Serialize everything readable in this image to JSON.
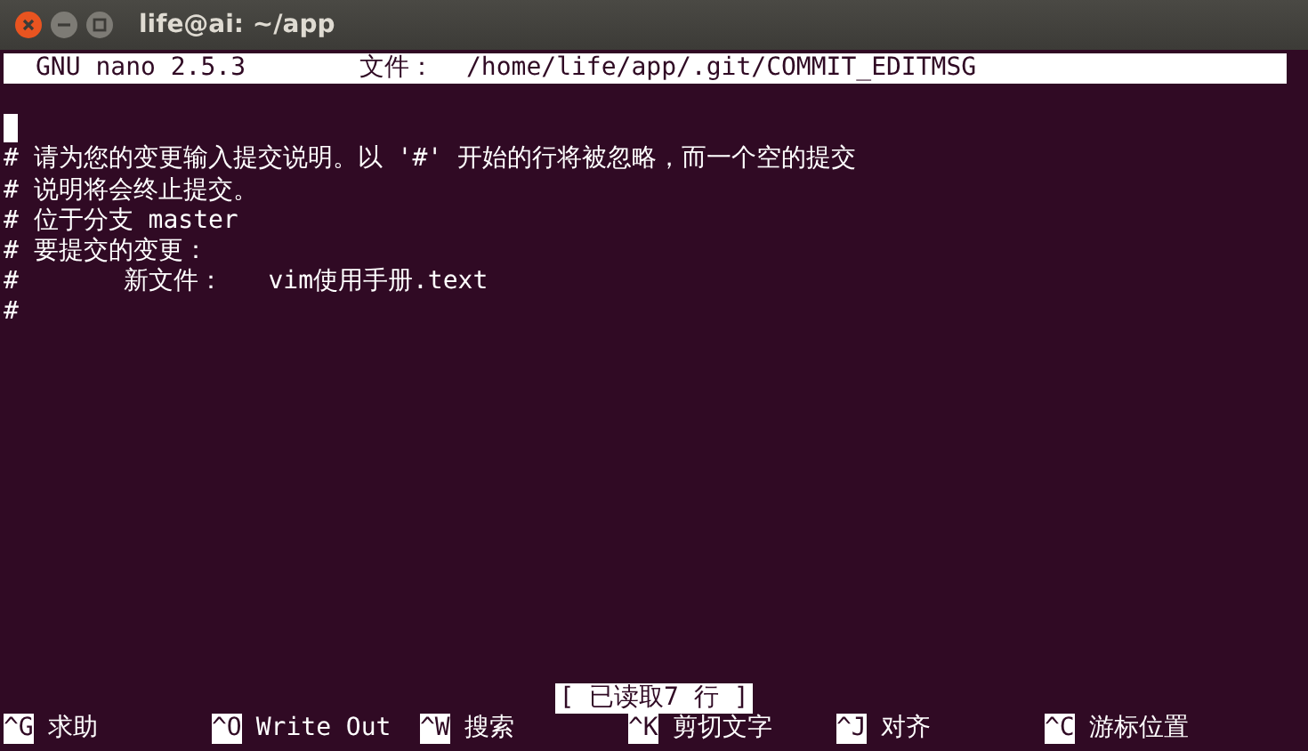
{
  "window": {
    "title": "life@ai: ~/app"
  },
  "nano_header": {
    "version": "GNU nano 2.5.3",
    "file_label": "文件：",
    "path": "/home/life/app/.git/COMMIT_EDITMSG"
  },
  "lines": [
    {
      "cursor": true
    },
    {
      "text": "# 请为您的变更输入提交说明。以 '#' 开始的行将被忽略，而一个空的提交",
      "cursor": false
    },
    {
      "text": "# 说明将会终止提交。",
      "cursor": false
    },
    {
      "text": "# 位于分支 master",
      "cursor": false
    },
    {
      "text": "# 要提交的变更：",
      "cursor": false
    },
    {
      "text": "#       新文件：   vim使用手册.text",
      "cursor": false
    },
    {
      "text": "#",
      "cursor": false
    }
  ],
  "status": "[ 已读取7 行 ]",
  "shortcuts": [
    {
      "key": "^G",
      "label": "求助"
    },
    {
      "key": "^O",
      "label": "Write Out"
    },
    {
      "key": "^W",
      "label": "搜索"
    },
    {
      "key": "^K",
      "label": "剪切文字"
    },
    {
      "key": "^J",
      "label": "对齐"
    },
    {
      "key": "^C",
      "label": "游标位置"
    }
  ]
}
